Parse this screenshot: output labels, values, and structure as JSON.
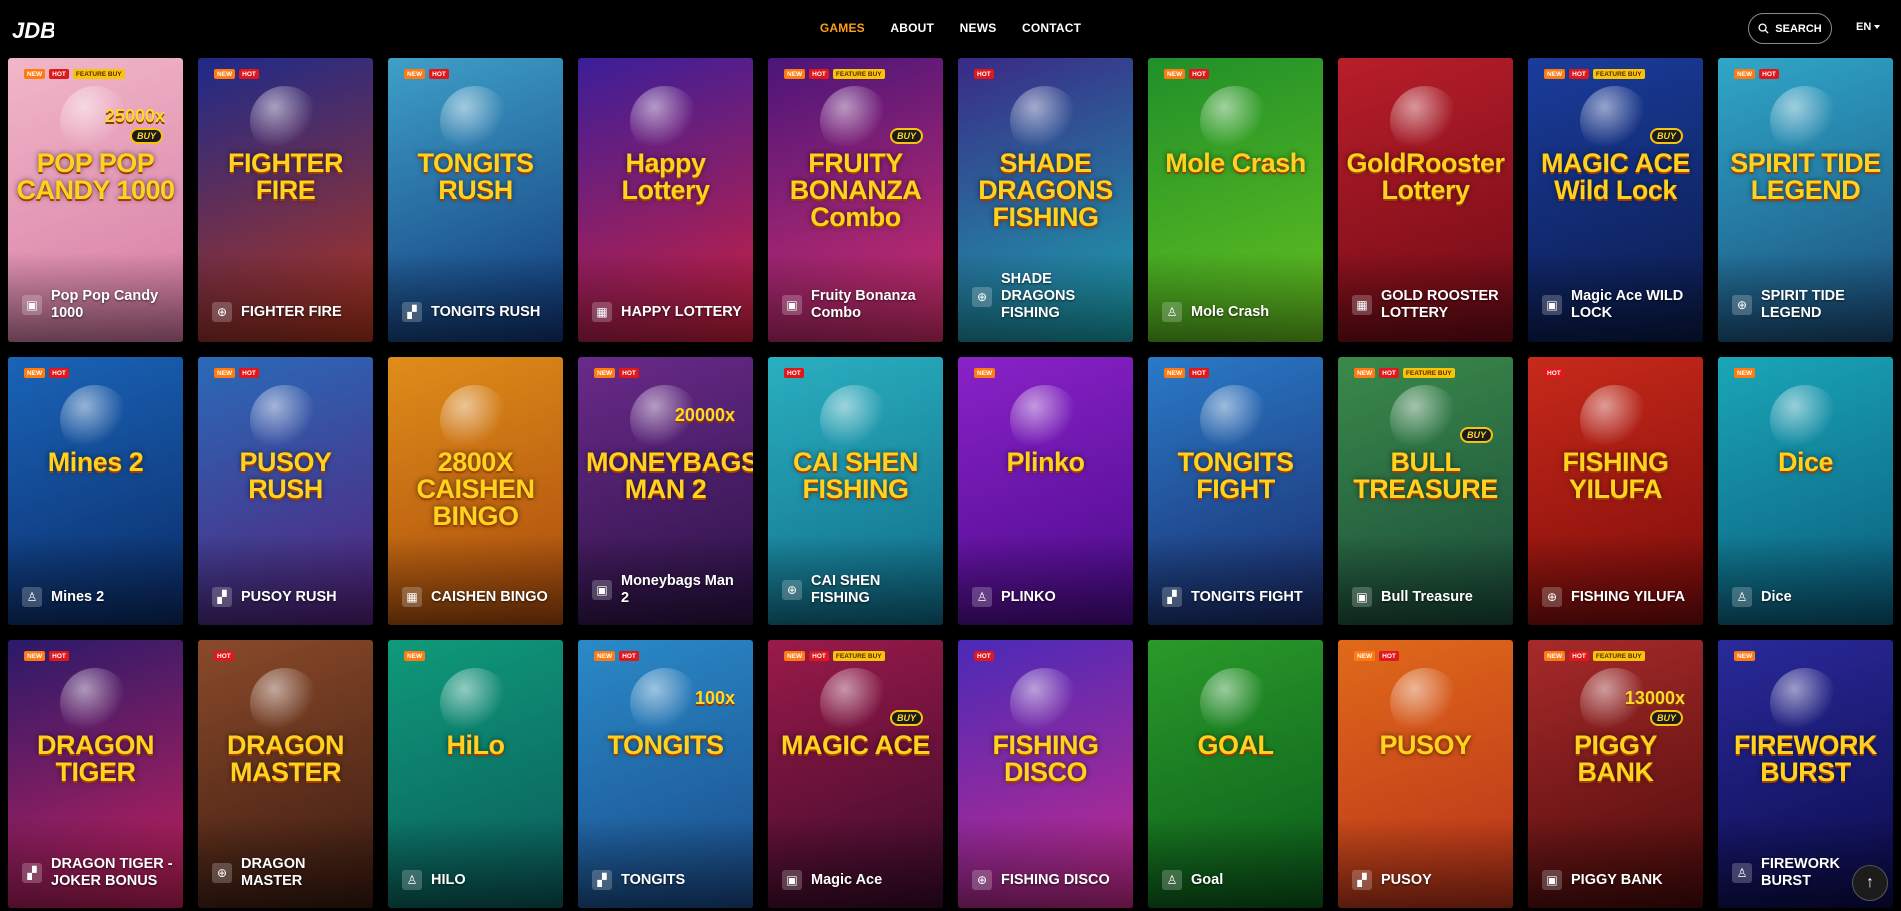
{
  "header": {
    "logo": "JDB",
    "nav": [
      "GAMES",
      "ABOUT",
      "NEWS",
      "CONTACT"
    ],
    "active_nav": "GAMES",
    "search_label": "SEARCH",
    "language": "EN"
  },
  "badge_labels": {
    "new": "NEW",
    "hot": "HOT",
    "fb": "FEATURE BUY"
  },
  "buy_label": "BUY",
  "scroll_top_icon": "arrow-up-icon",
  "games": [
    {
      "name": "Pop Pop Candy 1000",
      "category": "slot",
      "badges": [
        "new",
        "hot",
        "fb"
      ],
      "logo": "POP POP CANDY 1000",
      "mult": "25000x",
      "buy": true,
      "bg": "#f1b7c8,#d67aa3"
    },
    {
      "name": "FIGHTER FIRE",
      "category": "fishing",
      "badges": [
        "new",
        "hot"
      ],
      "logo": "FIGHTER FIRE",
      "bg": "#1e2a8a,#b3341a"
    },
    {
      "name": "TONGITS RUSH",
      "category": "card",
      "badges": [
        "new",
        "hot"
      ],
      "logo": "TONGITS RUSH",
      "bg": "#3ea0c8,#10367a"
    },
    {
      "name": "HAPPY LOTTERY",
      "category": "lottery",
      "badges": [],
      "logo": "Happy Lottery",
      "bg": "#3b1e9a,#d0203c"
    },
    {
      "name": "Fruity Bonanza Combo",
      "category": "slot",
      "badges": [
        "new",
        "hot",
        "fb"
      ],
      "logo": "FRUITY BONANZA Combo",
      "buy": true,
      "bg": "#4a157a,#d72f6b"
    },
    {
      "name": "SHADE DRAGONS FISHING",
      "category": "fishing",
      "badges": [
        "hot"
      ],
      "logo": "SHADE DRAGONS FISHING",
      "bg": "#3a2a86,#1aa6b0"
    },
    {
      "name": "Mole Crash",
      "category": "arcade",
      "badges": [
        "new",
        "hot"
      ],
      "logo": "Mole Crash",
      "bg": "#1f8f2a,#66c21f"
    },
    {
      "name": "GOLD ROOSTER LOTTERY",
      "category": "lottery",
      "badges": [],
      "logo": "GoldRooster Lottery",
      "bg": "#b81e2a,#6e0a15"
    },
    {
      "name": "Magic Ace WILD LOCK",
      "category": "slot",
      "badges": [
        "new",
        "hot",
        "fb"
      ],
      "logo": "MAGIC ACE Wild Lock",
      "buy": true,
      "bg": "#1a3c9c,#0a1a4a"
    },
    {
      "name": "SPIRIT TIDE LEGEND",
      "category": "fishing",
      "badges": [
        "new",
        "hot"
      ],
      "logo": "SPIRIT TIDE LEGEND",
      "bg": "#2fa7c9,#1b4c7a"
    },
    {
      "name": "Mines 2",
      "category": "arcade",
      "badges": [
        "new",
        "hot"
      ],
      "logo": "Mines 2",
      "bg": "#1a64b8,#0a2a66"
    },
    {
      "name": "PUSOY RUSH",
      "category": "card",
      "badges": [
        "new",
        "hot"
      ],
      "logo": "PUSOY RUSH",
      "bg": "#2a6ab8,#54207a"
    },
    {
      "name": "CAISHEN BINGO",
      "category": "lottery",
      "badges": [],
      "logo": "2800X CAISHEN BINGO",
      "bg": "#e08d1a,#a8490c"
    },
    {
      "name": "Moneybags Man 2",
      "category": "slot",
      "badges": [
        "new",
        "hot"
      ],
      "logo": "MONEYBAGS MAN 2",
      "mult": "20000x",
      "bg": "#6a2a8a,#2a1244"
    },
    {
      "name": "CAI SHEN FISHING",
      "category": "fishing",
      "badges": [
        "hot"
      ],
      "logo": "CAI SHEN FISHING",
      "bg": "#2ab0c0,#0f6a88"
    },
    {
      "name": "PLINKO",
      "category": "arcade",
      "badges": [
        "new"
      ],
      "logo": "Plinko",
      "bg": "#8a22c8,#4a0a8a"
    },
    {
      "name": "TONGITS FIGHT",
      "category": "card",
      "badges": [
        "new",
        "hot"
      ],
      "logo": "TONGITS FIGHT",
      "bg": "#2a7ac8,#1a2a6a"
    },
    {
      "name": "Bull Treasure",
      "category": "slot",
      "badges": [
        "new",
        "hot",
        "fb"
      ],
      "logo": "BULL TREASURE",
      "buy": true,
      "bg": "#3a8a4a,#1a4a3a"
    },
    {
      "name": "FISHING YILUFA",
      "category": "fishing",
      "badges": [
        "hot"
      ],
      "logo": "FISHING YILUFA",
      "bg": "#c82a1a,#7a0a0a"
    },
    {
      "name": "Dice",
      "category": "arcade",
      "badges": [
        "new"
      ],
      "logo": "Dice",
      "bg": "#1aa6b8,#0a5a7a"
    },
    {
      "name": "DRAGON TIGER - JOKER BONUS",
      "category": "card",
      "badges": [
        "new",
        "hot"
      ],
      "logo": "DRAGON TIGER",
      "bg": "#2a1a6a,#c8205a"
    },
    {
      "name": "DRAGON MASTER",
      "category": "fishing",
      "badges": [
        "hot"
      ],
      "logo": "DRAGON MASTER",
      "bg": "#8a4a2a,#3a1a10"
    },
    {
      "name": "HILO",
      "category": "arcade",
      "badges": [
        "new"
      ],
      "logo": "HiLo",
      "bg": "#0f9a7a,#0a5a5a"
    },
    {
      "name": "TONGITS",
      "category": "card",
      "badges": [
        "new",
        "hot"
      ],
      "logo": "TONGITS",
      "mult": "100x",
      "bg": "#2a8ac8,#1a4a8a"
    },
    {
      "name": "Magic Ace",
      "category": "slot",
      "badges": [
        "new",
        "hot",
        "fb"
      ],
      "logo": "MAGIC ACE",
      "buy": true,
      "bg": "#9a1a4a,#3a0a2a"
    },
    {
      "name": "FISHING DISCO",
      "category": "fishing",
      "badges": [
        "hot"
      ],
      "logo": "FISHING DISCO",
      "bg": "#4a2ab8,#c82a8a"
    },
    {
      "name": "Goal",
      "category": "arcade",
      "badges": [],
      "logo": "GOAL",
      "bg": "#2a9a2a,#0a5a1a"
    },
    {
      "name": "PUSOY",
      "category": "card",
      "badges": [
        "new",
        "hot"
      ],
      "logo": "PUSOY",
      "bg": "#e06a1a,#b8301a"
    },
    {
      "name": "PIGGY BANK",
      "category": "slot",
      "badges": [
        "new",
        "hot",
        "fb"
      ],
      "logo": "PIGGY BANK",
      "mult": "13000x",
      "buy": true,
      "bg": "#a82a2a,#4a0a0a"
    },
    {
      "name": "FIREWORK BURST",
      "category": "arcade",
      "badges": [
        "new"
      ],
      "logo": "FIREWORK BURST",
      "bg": "#2a2a9a,#0a0a4a"
    }
  ]
}
